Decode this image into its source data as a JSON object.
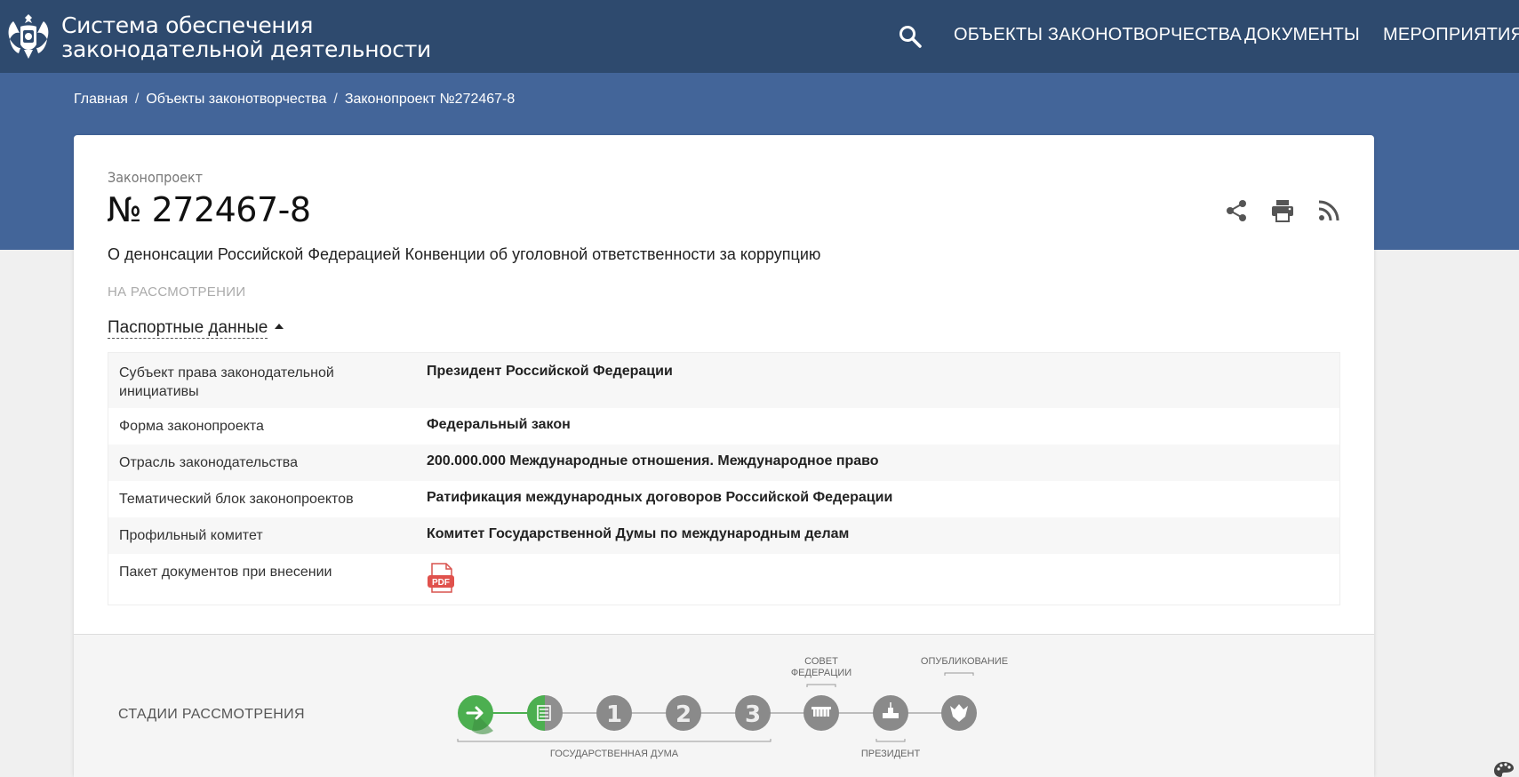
{
  "header": {
    "title_line1": "Система обеспечения",
    "title_line2": "законодательной деятельности",
    "nav": [
      "ОБЪЕКТЫ ЗАКОНОТВОРЧЕСТВА",
      "ДОКУМЕНТЫ",
      "МЕРОПРИЯТИЯ"
    ],
    "colors": {
      "header_bg": "#2e4a6e",
      "hero_bg": "#436599"
    }
  },
  "breadcrumb": [
    "Главная",
    "Объекты законотворчества",
    "Законопроект №272467-8"
  ],
  "bill": {
    "kind": "Законопроект",
    "number": "№ 272467-8",
    "title": "О денонсации Российской Федерацией Конвенции об уголовной ответственности за коррупцию",
    "status": "НА РАССМОТРЕНИИ",
    "actions": [
      "share-icon",
      "print-icon",
      "rss-icon"
    ]
  },
  "passport": {
    "toggle_label": "Паспортные данные",
    "rows": [
      {
        "key": "Субъект права законодательной инициативы",
        "value": "Президент Российской Федерации"
      },
      {
        "key": "Форма законопроекта",
        "value": "Федеральный закон"
      },
      {
        "key": "Отрасль законодательства",
        "value": "200.000.000 Международные отношения. Международное право"
      },
      {
        "key": "Тематический блок законопроектов",
        "value": "Ратификация международных договоров Российской Федерации"
      },
      {
        "key": "Профильный комитет",
        "value": "Комитет Государственной Думы по международным делам"
      },
      {
        "key": "Пакет документов при внесении",
        "value": "PDF"
      }
    ]
  },
  "stages": {
    "label": "СТАДИИ РАССМОТРЕНИЯ",
    "steps": [
      "→",
      "≡",
      "1",
      "2",
      "3",
      "СФ",
      "П",
      "О"
    ],
    "top_labels": {
      "federation_council_1": "СОВЕТ",
      "federation_council_2": "ФЕДЕРАЦИИ",
      "publication": "ОПУБЛИКОВАНИЕ"
    },
    "bottom_labels": {
      "duma": "ГОСУДАРСТВЕННАЯ ДУМА",
      "president": "ПРЕЗИДЕНТ"
    },
    "colors": {
      "done": "#4caf50",
      "pending": "#8a8a8a"
    }
  }
}
